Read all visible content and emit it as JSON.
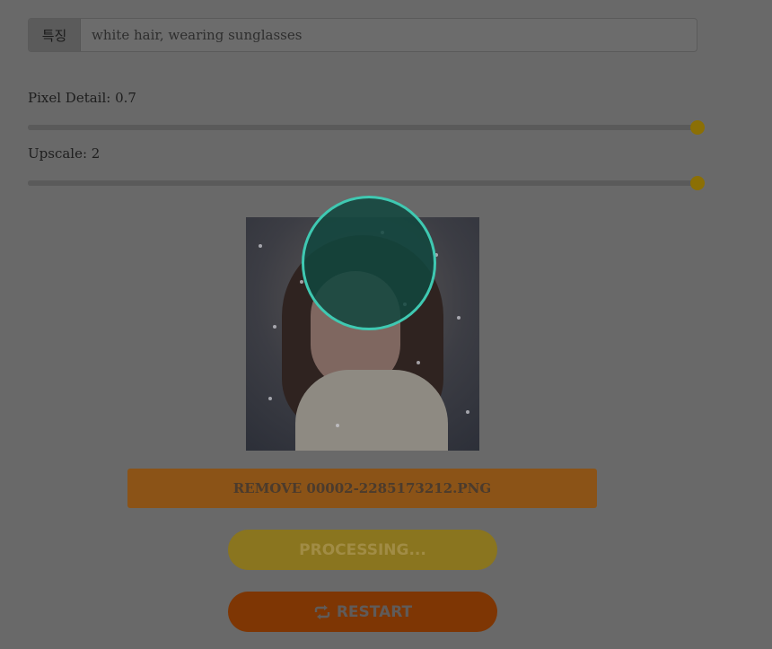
{
  "feature_input": {
    "addon_label": "특징",
    "placeholder": "white hair, wearing sunglasses",
    "value": ""
  },
  "sliders": [
    {
      "label": "Pixel Detail: 0.7",
      "fraction": 1.0
    },
    {
      "label": "Upscale: 2",
      "fraction": 1.0
    }
  ],
  "buttons": {
    "remove_label": "REMOVE 00002-2285173212.PNG",
    "processing_label": "PROCESSING...",
    "restart_label": "RESTART"
  },
  "colors": {
    "overlay_bg": "#696969",
    "slider_thumb": "#8b6f05",
    "loader_ring": "#3fc9b2",
    "remove_button": "#8b5317",
    "processing_button": "#8a751f",
    "restart_button": "#7e3604"
  },
  "icons": {
    "restart": "repeat-icon"
  }
}
